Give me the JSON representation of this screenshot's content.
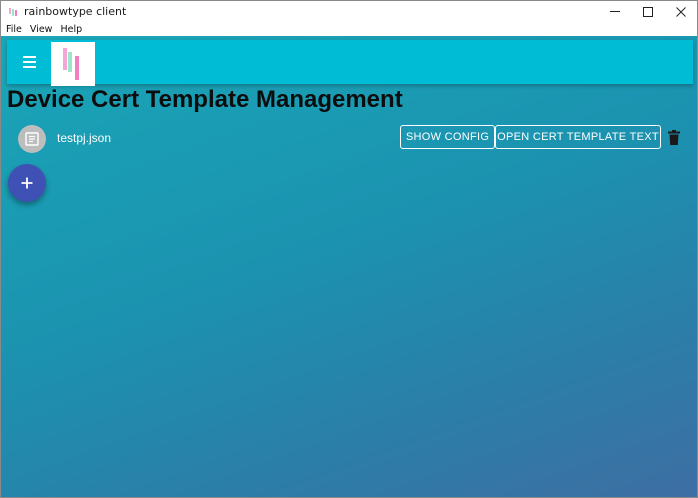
{
  "window": {
    "title": "rainbowtype client"
  },
  "menu": {
    "file": "File",
    "view": "View",
    "help": "Help"
  },
  "appbar": {
    "menu_icon": "hamburger-icon",
    "logo": "rainbowtype-logo"
  },
  "page": {
    "title": "Device Cert Template Management"
  },
  "files": [
    {
      "name": "testpj.json",
      "icon": "document-icon",
      "show_config_label": "SHOW CONFIG",
      "open_cert_label": "OPEN CERT TEMPLATE TEXT",
      "delete_icon": "trash-icon"
    }
  ],
  "fab": {
    "icon": "plus-icon"
  },
  "colors": {
    "appbar": "#00bcd4",
    "fab": "#3f51b5",
    "background_top": "#1aa6b8",
    "background_bottom": "#3e6ea3",
    "avatar": "#bdbdbd"
  }
}
